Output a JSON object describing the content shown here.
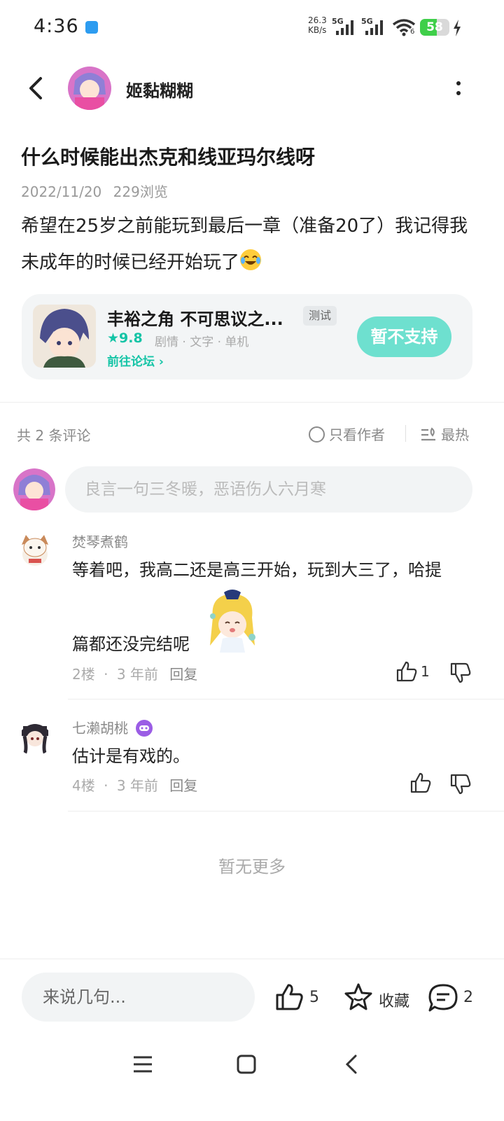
{
  "status_bar": {
    "time": "4:36",
    "net_speed_value": "26.3",
    "net_speed_unit": "KB/s",
    "signal1_label": "5G",
    "signal2_label": "5G",
    "wifi_sub": "6",
    "battery": "58",
    "battery_level": 0.58
  },
  "header": {
    "author_name": "姬黏糊糊"
  },
  "post": {
    "title": "什么时候能出杰克和线亚玛尔线呀",
    "date": "2022/11/20",
    "views": "229浏览",
    "body": "希望在25岁之前能玩到最后一章（准备20了）我记得我未成年的时候已经开始玩了"
  },
  "game": {
    "title": "丰裕之角 不可思议之...",
    "tag": "测试",
    "score": "★9.8",
    "genres": "剧情 · 文字 · 单机",
    "forum_link": "前往论坛 ›",
    "button": "暂不支持"
  },
  "comments_header": {
    "count": "共 2 条评论",
    "only_author": "只看作者",
    "sort": "最热"
  },
  "comment_input": {
    "placeholder": "良言一句三冬暖，恶语伤人六月寒"
  },
  "comments": [
    {
      "user": "焚琴煮鹤",
      "text_line1": "等着吧，我高二还是高三开始，玩到大三了，哈提",
      "text_line2": "篇都还没完结呢",
      "floor": "2楼",
      "time": "3 年前",
      "reply": "回复",
      "likes": "1"
    },
    {
      "user": "七濑胡桃",
      "text": "估计是有戏的。",
      "floor": "4楼",
      "time": "3 年前",
      "reply": "回复",
      "likes": ""
    }
  ],
  "no_more": "暂无更多",
  "bottom_bar": {
    "input_placeholder": "来说几句...",
    "likes": "5",
    "favorite": "收藏",
    "comments": "2"
  },
  "colors": {
    "accent": "#14c4a6",
    "button": "#6ee0cf",
    "battery": "#3fcf4a"
  }
}
